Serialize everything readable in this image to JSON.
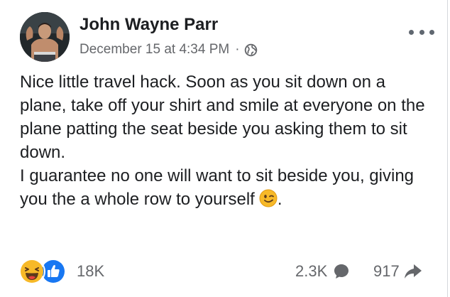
{
  "post": {
    "author": "John Wayne Parr",
    "timestamp": "December 15 at 4:34 PM",
    "separator": "·",
    "audience_icon": "globe-icon",
    "lines": [
      "Nice little travel hack. Soon as you sit down on a plane, take off your shirt and smile at everyone on the plane patting the seat beside you asking them to sit down.",
      "I guarantee no one will want to sit beside you, giving you the a whole row to yourself"
    ],
    "emoji": "wink-emoji"
  },
  "footer": {
    "reactions": [
      "haha",
      "like"
    ],
    "reaction_count": "18K",
    "comment_count": "2.3K",
    "share_count": "917"
  },
  "colors": {
    "text": "#1c1e21",
    "secondary": "#65676b",
    "like_blue": "#1877f2",
    "haha_yellow": "#f7b928"
  }
}
